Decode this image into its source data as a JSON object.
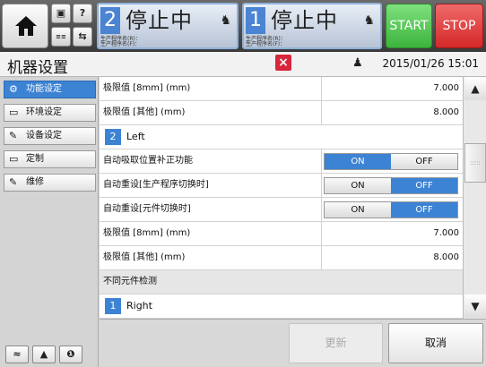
{
  "header": {
    "small_btn_1": "▣",
    "small_btn_2": "?",
    "small_btn_3": "≡≡",
    "small_btn_4": "⇆",
    "lanes": [
      {
        "num": "2",
        "status": "停止中",
        "info_line1": "生产程序名(R)：",
        "info_line2": "生产程序名(F)："
      },
      {
        "num": "1",
        "status": "停止中",
        "info_line1": "生产程序名(R)：",
        "info_line2": "生产程序名(F)："
      }
    ],
    "start_label": "START",
    "stop_label": "STOP"
  },
  "titlebar": {
    "title": "机器设置",
    "close_label": "×",
    "datetime": "2015/01/26 15:01"
  },
  "sidebar": {
    "items": [
      {
        "label": "功能设定",
        "icon": "gear-icon",
        "glyph": "⚙",
        "active": true
      },
      {
        "label": "环境设定",
        "icon": "monitor-icon",
        "glyph": "▭",
        "active": false
      },
      {
        "label": "设备设定",
        "icon": "device-icon",
        "glyph": "✎",
        "active": false
      },
      {
        "label": "定制",
        "icon": "custom-icon",
        "glyph": "▭",
        "active": false
      },
      {
        "label": "维修",
        "icon": "maintenance-icon",
        "glyph": "✎",
        "active": false
      }
    ],
    "bottom": [
      "≈",
      "▲",
      "❶"
    ]
  },
  "content": {
    "rows": [
      {
        "type": "value",
        "label": "极限值 [8mm] (mm)",
        "value": "7.000"
      },
      {
        "type": "value",
        "label": "极限值 [其他] (mm)",
        "value": "8.000"
      },
      {
        "type": "group",
        "num": "2",
        "label": "Left"
      },
      {
        "type": "toggle",
        "label": "自动吸取位置补正功能",
        "on": "ON",
        "off": "OFF",
        "selected": "on"
      },
      {
        "type": "toggle",
        "label": "自动重设[生产程序切换时]",
        "on": "ON",
        "off": "OFF",
        "selected": "off"
      },
      {
        "type": "toggle",
        "label": "自动重设[元件切换时]",
        "on": "ON",
        "off": "OFF",
        "selected": "off"
      },
      {
        "type": "value",
        "label": "极限值 [8mm] (mm)",
        "value": "7.000"
      },
      {
        "type": "value",
        "label": "极限值 [其他] (mm)",
        "value": "8.000"
      },
      {
        "type": "section",
        "label": "不同元件检测"
      },
      {
        "type": "group",
        "num": "1",
        "label": "Right"
      }
    ]
  },
  "bottom": {
    "update_label": "更新",
    "cancel_label": "取消"
  },
  "scrollbar": {
    "up": "▲",
    "down": "▼"
  }
}
